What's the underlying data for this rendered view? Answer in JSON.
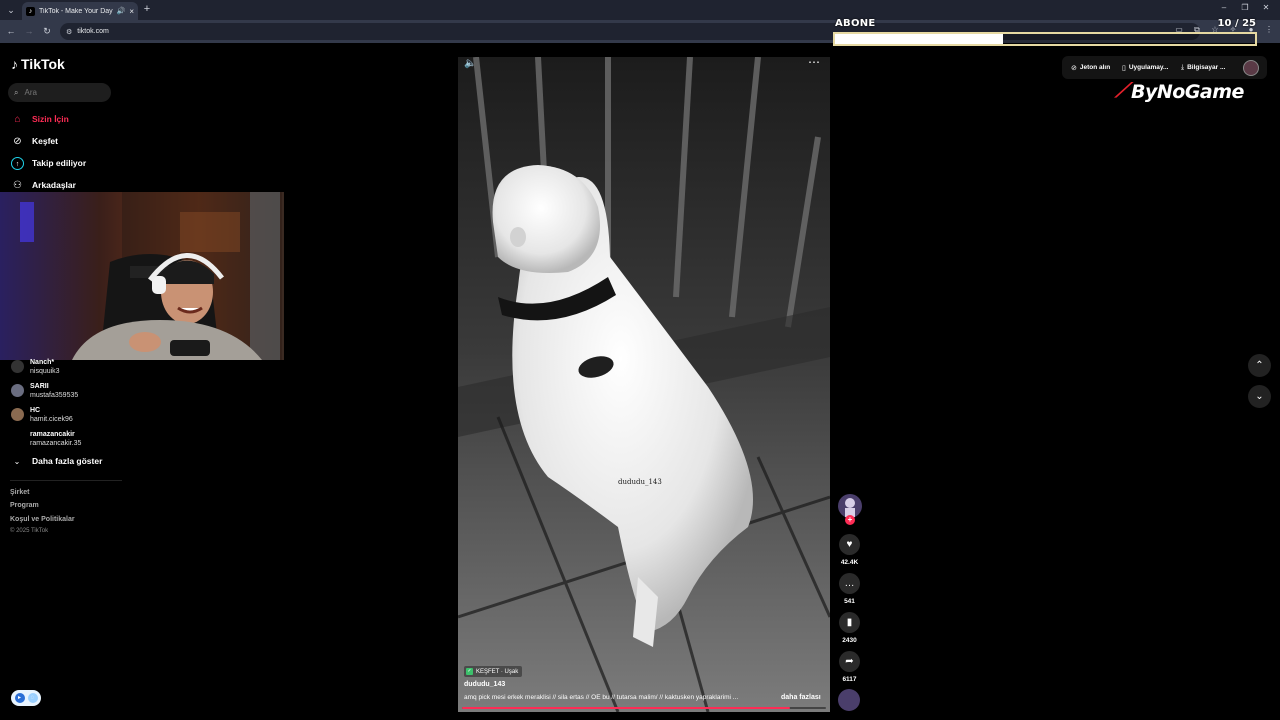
{
  "browser": {
    "tab_title": "TikTok - Make Your Day",
    "url": "tiktok.com"
  },
  "overlay": {
    "goal_label": "ABONE",
    "goal_count": "10 / 25",
    "goal_progress": 0.4,
    "sponsor_name": "ByNoGame"
  },
  "tiktok": {
    "logo_text": "TikTok",
    "search_placeholder": "Ara",
    "nav": [
      {
        "label": "Sizin İçin",
        "icon": "home-icon"
      },
      {
        "label": "Keşfet",
        "icon": "compass-icon"
      },
      {
        "label": "Takip ediliyor",
        "icon": "following-icon"
      },
      {
        "label": "Arkadaşlar",
        "icon": "friends-icon"
      }
    ],
    "following_accounts": [
      {
        "name": "Nanch*",
        "username": "nisquuik3"
      },
      {
        "name": "SARII",
        "username": "mustafa359535"
      },
      {
        "name": "HC",
        "username": "hamit.cicek96"
      },
      {
        "name": "ramazancakir",
        "username": "ramazancakir.35"
      }
    ],
    "show_more": "Daha fazla göster",
    "footer": [
      "Şirket",
      "Program",
      "Koşul ve Politikalar"
    ],
    "copyright": "© 2025 TikTok",
    "topbar": {
      "coins": "Jeton alın",
      "app": "Uygulamay...",
      "computer": "Bilgisayar ..."
    }
  },
  "video": {
    "watermark": "dududu_143",
    "explore_tag": "KEŞFET · Uşak",
    "author": "dududu_143",
    "caption": "amq pick mesi erkek meraklisi // sila ertas // OE bu // tutarsa malim/ // kaktusken yapraklarimi ...",
    "more_label": "daha fazlası",
    "progress": 0.9,
    "likes": "42.4K",
    "comments": "541",
    "saves": "2430",
    "shares": "6117"
  }
}
